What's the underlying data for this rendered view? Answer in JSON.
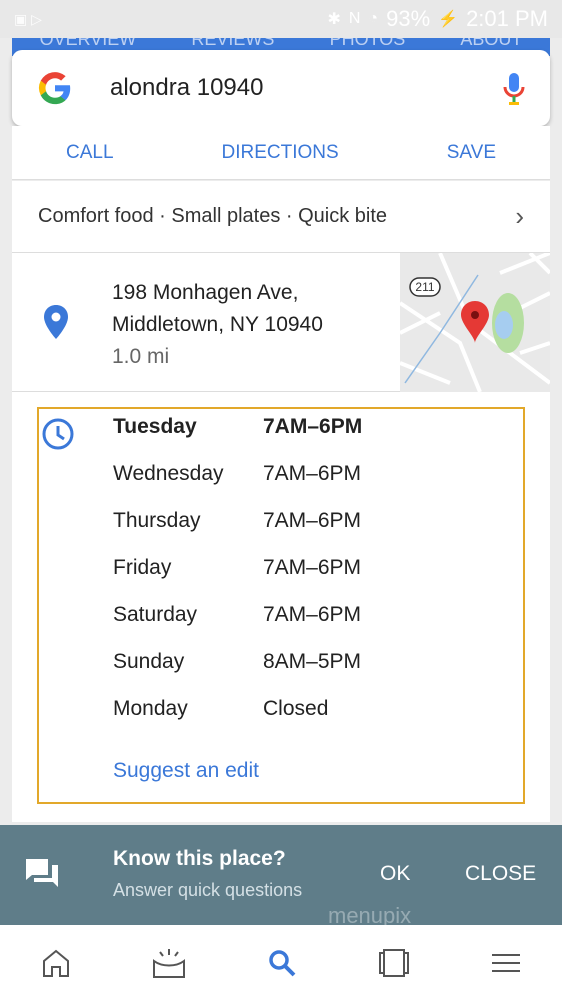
{
  "status_bar": {
    "battery": "93%",
    "time": "2:01 PM"
  },
  "tabs": [
    "OVERVIEW",
    "REVIEWS",
    "PHOTOS",
    "ABOUT"
  ],
  "search": {
    "query": "alondra 10940"
  },
  "actions": {
    "call": "CALL",
    "directions": "DIRECTIONS",
    "save": "SAVE"
  },
  "categories": "Comfort food · Small plates · Quick bite",
  "address": {
    "line1": "198 Monhagen Ave,",
    "line2": "Middletown, NY 10940",
    "distance": "1.0 mi",
    "route_badge": "211"
  },
  "hours": [
    {
      "day": "Tuesday",
      "time": "7AM–6PM"
    },
    {
      "day": "Wednesday",
      "time": "7AM–6PM"
    },
    {
      "day": "Thursday",
      "time": "7AM–6PM"
    },
    {
      "day": "Friday",
      "time": "7AM–6PM"
    },
    {
      "day": "Saturday",
      "time": "7AM–6PM"
    },
    {
      "day": "Sunday",
      "time": "8AM–5PM"
    },
    {
      "day": "Monday",
      "time": "Closed"
    }
  ],
  "suggest_edit": "Suggest an edit",
  "banner": {
    "title": "Know this place?",
    "subtitle": "Answer quick questions",
    "ok": "OK",
    "close": "CLOSE",
    "watermark": "menupix"
  },
  "colors": {
    "accent": "#3b78d8",
    "highlight_border": "#e2a82a",
    "banner": "#5f7d89"
  }
}
